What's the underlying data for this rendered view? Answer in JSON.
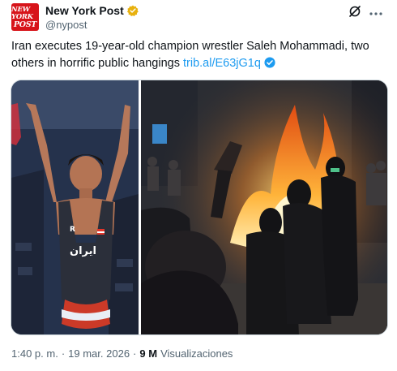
{
  "account": {
    "name": "New York Post",
    "handle": "@nypost",
    "avatar_line1": "NEW YORK",
    "avatar_line2": "POST",
    "avatar_color": "#d7141a",
    "verified_badge": "gold-check-icon"
  },
  "icons": {
    "grok": "grok-icon",
    "more": "more-options-icon"
  },
  "tweet": {
    "text": "Iran executes 19-year-old champion wrestler Saleh Mohammadi, two others in horrific public hangings ",
    "link": "trib.al/E63jG1q"
  },
  "media": {
    "left_singlet_text": "ایران",
    "left_singlet_letter": "R"
  },
  "footer": {
    "time": "1:40 p. m.",
    "separator": "·",
    "date": "19 mar. 2026",
    "views_count": "9 M",
    "views_label": "Visualizaciones"
  },
  "colors": {
    "link": "#1d9bf0",
    "secondary_text": "#536471",
    "primary_text": "#0f1419",
    "gold_badge": "#e8b10e"
  }
}
